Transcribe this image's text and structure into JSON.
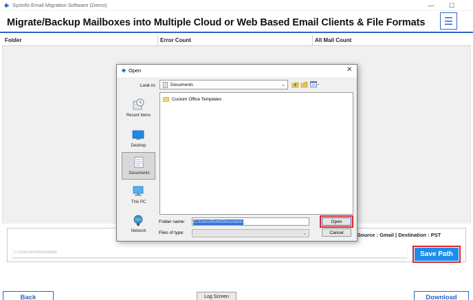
{
  "window": {
    "title": "SysInfo Email Migration Software (Demo)",
    "minimize_glyph": "—",
    "maximize_glyph": "☐"
  },
  "header": {
    "title": "Migrate/Backup Mailboxes into Multiple Cloud or Web Based Email Clients & File Formats",
    "menu_glyph": "☰"
  },
  "table": {
    "columns": [
      "Folder",
      "Error Count",
      "All Mail Count"
    ]
  },
  "bottom": {
    "source_dest": "Source : Gmail | Destination : PST",
    "path_value": "C:\\Users\\Rohit\\Desktop",
    "save_path_label": "Save Path"
  },
  "footer": {
    "back_label": "Back",
    "log_label": "Log Screen",
    "download_label": "Download"
  },
  "dialog": {
    "title": "Open",
    "close_glyph": "✕",
    "look_in_label": "Look in:",
    "look_in_value": "Documents",
    "places": [
      {
        "label": "Recent Items",
        "icon": "recent-items-icon"
      },
      {
        "label": "Desktop",
        "icon": "desktop-icon"
      },
      {
        "label": "Documents",
        "icon": "documents-icon"
      },
      {
        "label": "This PC",
        "icon": "this-pc-icon"
      },
      {
        "label": "Network",
        "icon": "network-icon"
      }
    ],
    "files": [
      {
        "name": "Custom Office Templates",
        "icon": "folder-icon"
      }
    ],
    "folder_name_label": "Folder name:",
    "folder_name_value": "C:\\Users\\Rohit\\Documents",
    "files_of_type_label": "Files of type:",
    "files_of_type_value": "",
    "open_label": "Open",
    "cancel_label": "Cancel"
  },
  "colors": {
    "accent": "#2b65c8",
    "save_button": "#1c8dec",
    "highlight": "#d8232a"
  }
}
